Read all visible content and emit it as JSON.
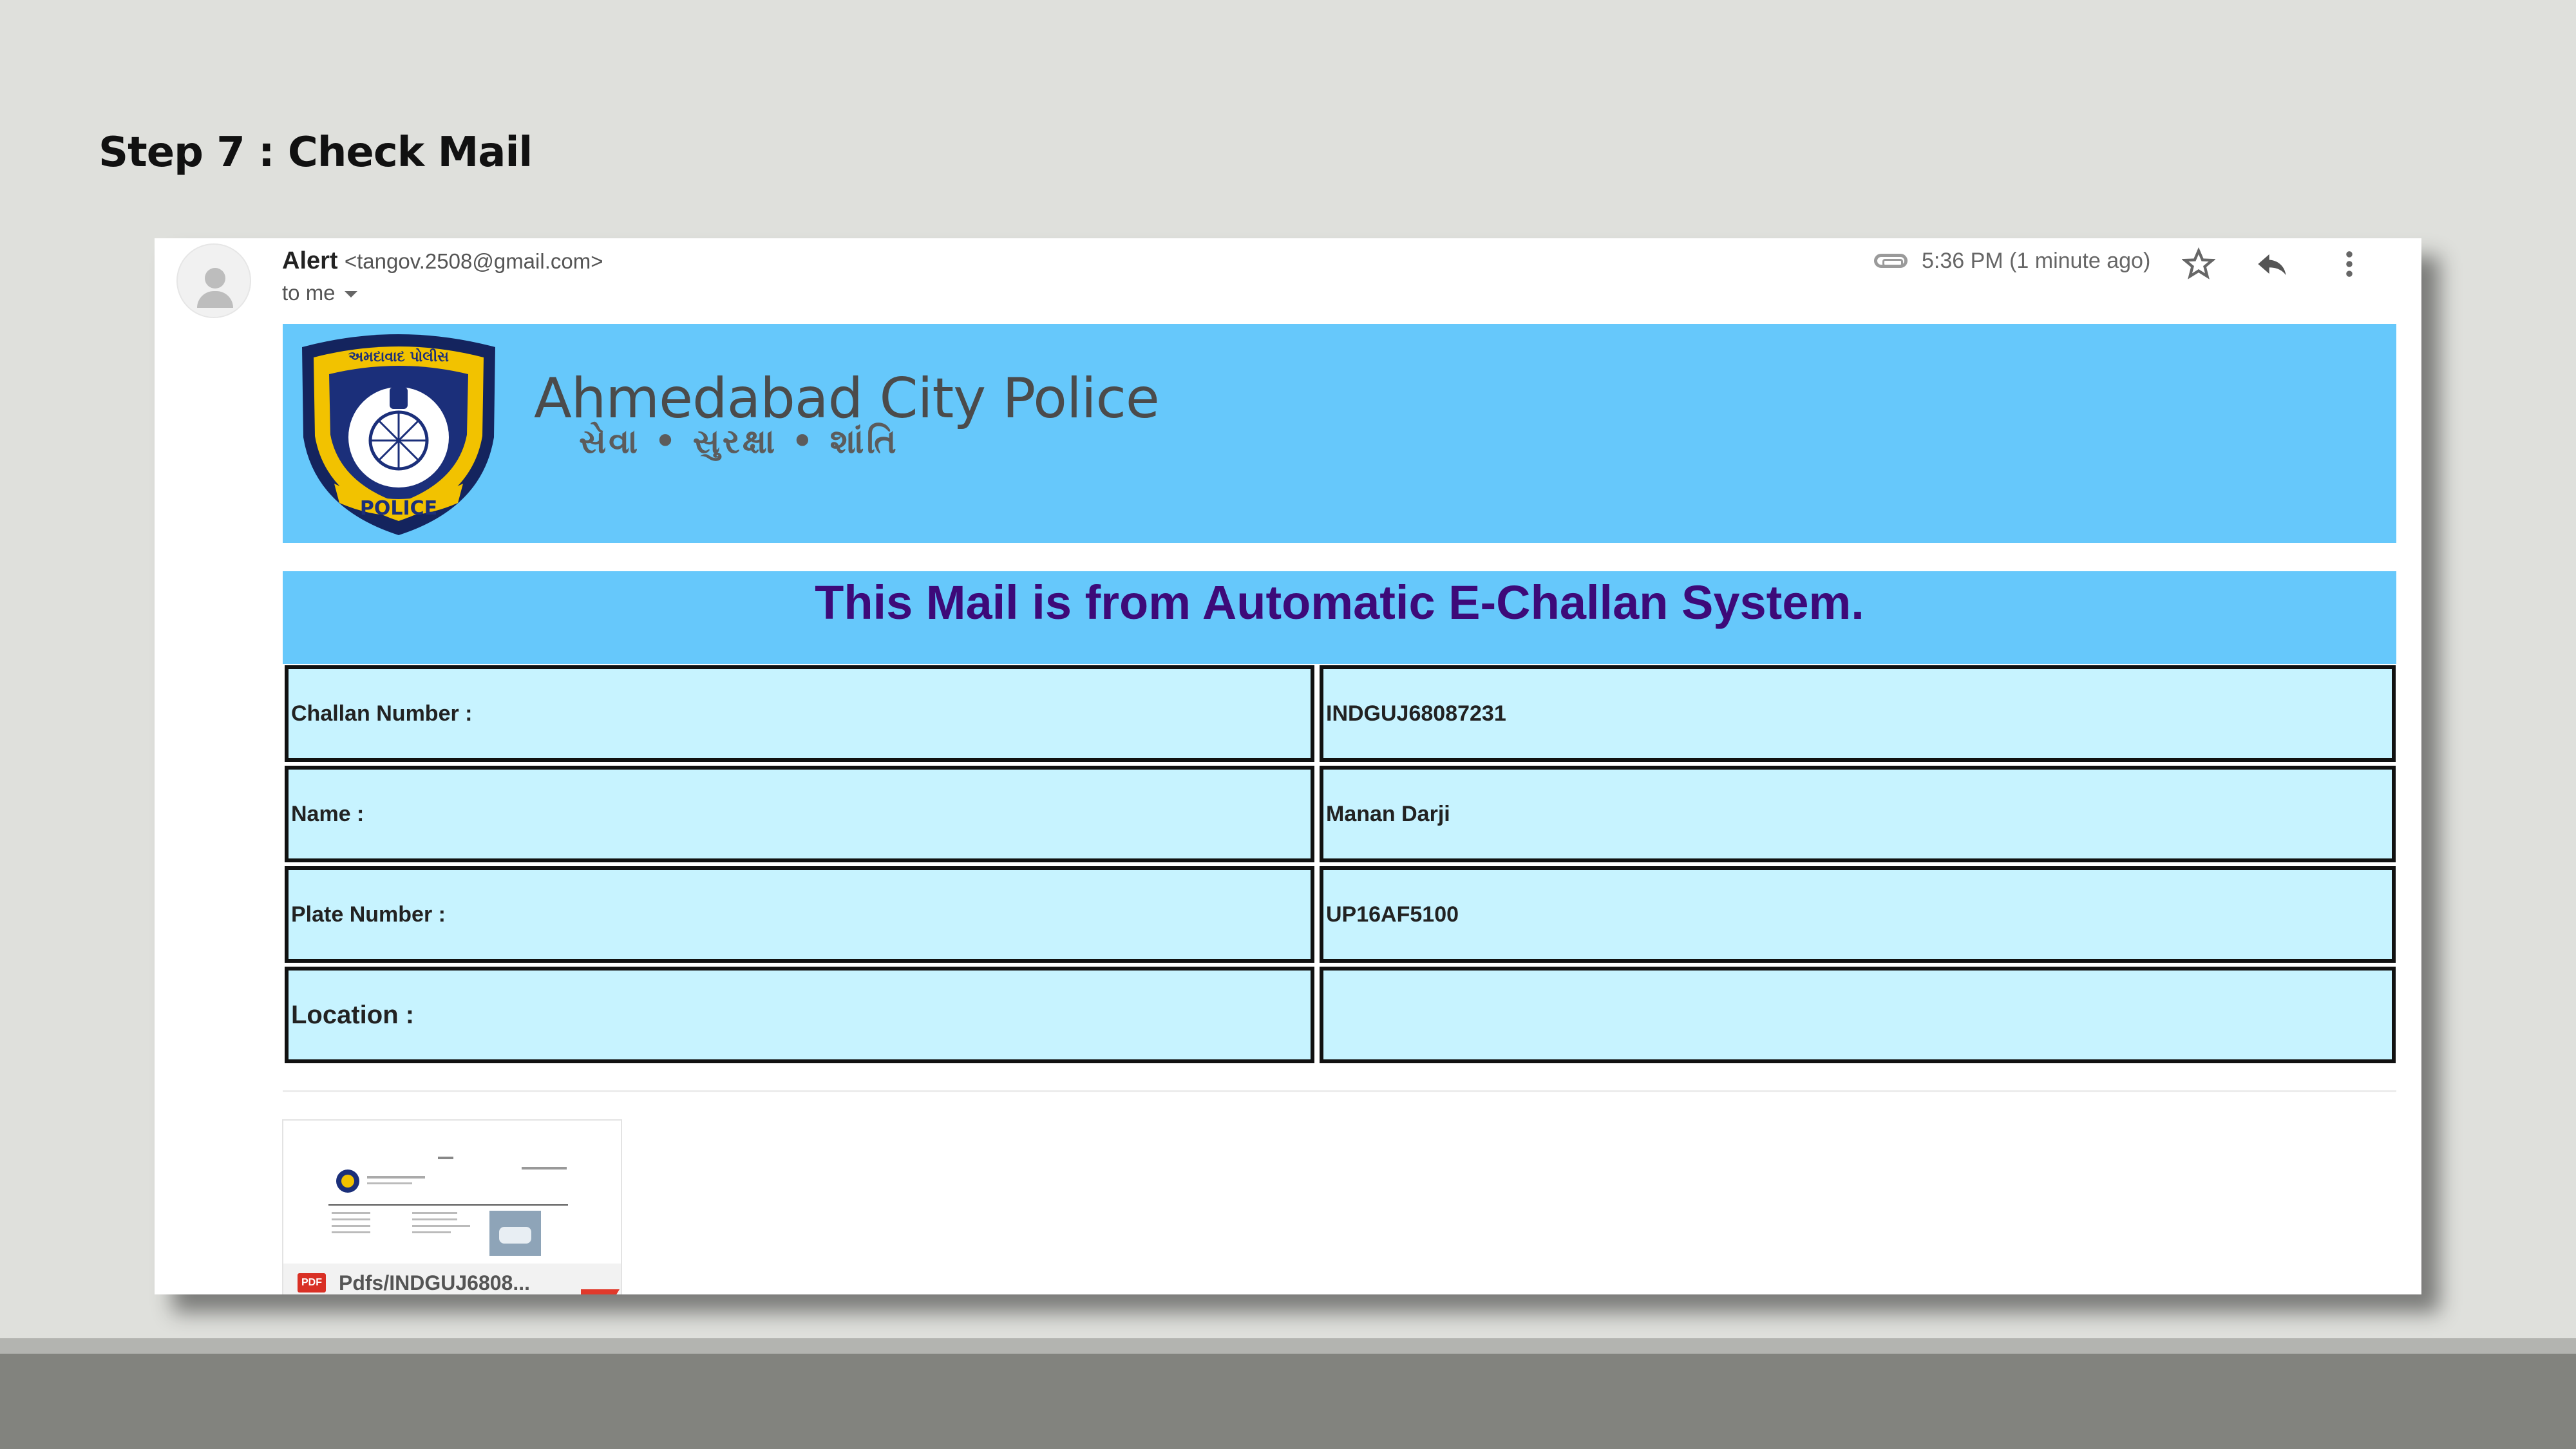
{
  "slide": {
    "title": "Step 7 : Check Mail"
  },
  "mail": {
    "sender_name": "Alert",
    "sender_email": "<tangov.2508@gmail.com>",
    "recipient": "to me",
    "time": "5:36 PM (1 minute ago)",
    "icons": {
      "attachment": "paperclip-icon",
      "star": "star-icon",
      "reply": "reply-icon",
      "more": "more-vert-icon",
      "avatar": "person-avatar-icon"
    }
  },
  "email_body": {
    "banner": {
      "org_name": "Ahmedabad City Police",
      "motto": "સેવા • સુરક્ષા • શાંતિ",
      "badge_top_text": "અમદાવાદ પોલીસ",
      "badge_bottom_text": "POLICE",
      "background": "#66c8fb"
    },
    "headline": "This Mail is from Automatic E-Challan System.",
    "details": [
      {
        "label": "Challan Number :",
        "value": "INDGUJ68087231"
      },
      {
        "label": "Name :",
        "value": "Manan Darji"
      },
      {
        "label": "Plate Number :",
        "value": "UP16AF5100"
      },
      {
        "label": "Location :",
        "value": ""
      }
    ],
    "colors": {
      "headline": "#3d0a79",
      "cell_bg": "#c7f3ff"
    }
  },
  "attachment": {
    "type_label": "PDF",
    "file_name": "Pdfs/INDGUJ6808..."
  }
}
